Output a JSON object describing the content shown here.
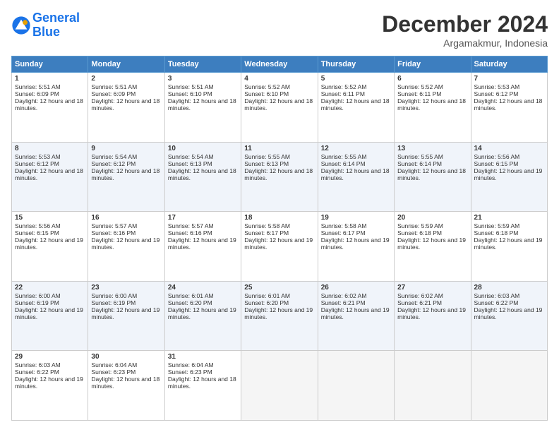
{
  "header": {
    "logo_line1": "General",
    "logo_line2": "Blue",
    "month_year": "December 2024",
    "location": "Argamakmur, Indonesia"
  },
  "days_of_week": [
    "Sunday",
    "Monday",
    "Tuesday",
    "Wednesday",
    "Thursday",
    "Friday",
    "Saturday"
  ],
  "weeks": [
    [
      {
        "day": "1",
        "sunrise": "Sunrise: 5:51 AM",
        "sunset": "Sunset: 6:09 PM",
        "daylight": "Daylight: 12 hours and 18 minutes."
      },
      {
        "day": "2",
        "sunrise": "Sunrise: 5:51 AM",
        "sunset": "Sunset: 6:09 PM",
        "daylight": "Daylight: 12 hours and 18 minutes."
      },
      {
        "day": "3",
        "sunrise": "Sunrise: 5:51 AM",
        "sunset": "Sunset: 6:10 PM",
        "daylight": "Daylight: 12 hours and 18 minutes."
      },
      {
        "day": "4",
        "sunrise": "Sunrise: 5:52 AM",
        "sunset": "Sunset: 6:10 PM",
        "daylight": "Daylight: 12 hours and 18 minutes."
      },
      {
        "day": "5",
        "sunrise": "Sunrise: 5:52 AM",
        "sunset": "Sunset: 6:11 PM",
        "daylight": "Daylight: 12 hours and 18 minutes."
      },
      {
        "day": "6",
        "sunrise": "Sunrise: 5:52 AM",
        "sunset": "Sunset: 6:11 PM",
        "daylight": "Daylight: 12 hours and 18 minutes."
      },
      {
        "day": "7",
        "sunrise": "Sunrise: 5:53 AM",
        "sunset": "Sunset: 6:12 PM",
        "daylight": "Daylight: 12 hours and 18 minutes."
      }
    ],
    [
      {
        "day": "8",
        "sunrise": "Sunrise: 5:53 AM",
        "sunset": "Sunset: 6:12 PM",
        "daylight": "Daylight: 12 hours and 18 minutes."
      },
      {
        "day": "9",
        "sunrise": "Sunrise: 5:54 AM",
        "sunset": "Sunset: 6:12 PM",
        "daylight": "Daylight: 12 hours and 18 minutes."
      },
      {
        "day": "10",
        "sunrise": "Sunrise: 5:54 AM",
        "sunset": "Sunset: 6:13 PM",
        "daylight": "Daylight: 12 hours and 18 minutes."
      },
      {
        "day": "11",
        "sunrise": "Sunrise: 5:55 AM",
        "sunset": "Sunset: 6:13 PM",
        "daylight": "Daylight: 12 hours and 18 minutes."
      },
      {
        "day": "12",
        "sunrise": "Sunrise: 5:55 AM",
        "sunset": "Sunset: 6:14 PM",
        "daylight": "Daylight: 12 hours and 18 minutes."
      },
      {
        "day": "13",
        "sunrise": "Sunrise: 5:55 AM",
        "sunset": "Sunset: 6:14 PM",
        "daylight": "Daylight: 12 hours and 18 minutes."
      },
      {
        "day": "14",
        "sunrise": "Sunrise: 5:56 AM",
        "sunset": "Sunset: 6:15 PM",
        "daylight": "Daylight: 12 hours and 19 minutes."
      }
    ],
    [
      {
        "day": "15",
        "sunrise": "Sunrise: 5:56 AM",
        "sunset": "Sunset: 6:15 PM",
        "daylight": "Daylight: 12 hours and 19 minutes."
      },
      {
        "day": "16",
        "sunrise": "Sunrise: 5:57 AM",
        "sunset": "Sunset: 6:16 PM",
        "daylight": "Daylight: 12 hours and 19 minutes."
      },
      {
        "day": "17",
        "sunrise": "Sunrise: 5:57 AM",
        "sunset": "Sunset: 6:16 PM",
        "daylight": "Daylight: 12 hours and 19 minutes."
      },
      {
        "day": "18",
        "sunrise": "Sunrise: 5:58 AM",
        "sunset": "Sunset: 6:17 PM",
        "daylight": "Daylight: 12 hours and 19 minutes."
      },
      {
        "day": "19",
        "sunrise": "Sunrise: 5:58 AM",
        "sunset": "Sunset: 6:17 PM",
        "daylight": "Daylight: 12 hours and 19 minutes."
      },
      {
        "day": "20",
        "sunrise": "Sunrise: 5:59 AM",
        "sunset": "Sunset: 6:18 PM",
        "daylight": "Daylight: 12 hours and 19 minutes."
      },
      {
        "day": "21",
        "sunrise": "Sunrise: 5:59 AM",
        "sunset": "Sunset: 6:18 PM",
        "daylight": "Daylight: 12 hours and 19 minutes."
      }
    ],
    [
      {
        "day": "22",
        "sunrise": "Sunrise: 6:00 AM",
        "sunset": "Sunset: 6:19 PM",
        "daylight": "Daylight: 12 hours and 19 minutes."
      },
      {
        "day": "23",
        "sunrise": "Sunrise: 6:00 AM",
        "sunset": "Sunset: 6:19 PM",
        "daylight": "Daylight: 12 hours and 19 minutes."
      },
      {
        "day": "24",
        "sunrise": "Sunrise: 6:01 AM",
        "sunset": "Sunset: 6:20 PM",
        "daylight": "Daylight: 12 hours and 19 minutes."
      },
      {
        "day": "25",
        "sunrise": "Sunrise: 6:01 AM",
        "sunset": "Sunset: 6:20 PM",
        "daylight": "Daylight: 12 hours and 19 minutes."
      },
      {
        "day": "26",
        "sunrise": "Sunrise: 6:02 AM",
        "sunset": "Sunset: 6:21 PM",
        "daylight": "Daylight: 12 hours and 19 minutes."
      },
      {
        "day": "27",
        "sunrise": "Sunrise: 6:02 AM",
        "sunset": "Sunset: 6:21 PM",
        "daylight": "Daylight: 12 hours and 19 minutes."
      },
      {
        "day": "28",
        "sunrise": "Sunrise: 6:03 AM",
        "sunset": "Sunset: 6:22 PM",
        "daylight": "Daylight: 12 hours and 19 minutes."
      }
    ],
    [
      {
        "day": "29",
        "sunrise": "Sunrise: 6:03 AM",
        "sunset": "Sunset: 6:22 PM",
        "daylight": "Daylight: 12 hours and 19 minutes."
      },
      {
        "day": "30",
        "sunrise": "Sunrise: 6:04 AM",
        "sunset": "Sunset: 6:23 PM",
        "daylight": "Daylight: 12 hours and 18 minutes."
      },
      {
        "day": "31",
        "sunrise": "Sunrise: 6:04 AM",
        "sunset": "Sunset: 6:23 PM",
        "daylight": "Daylight: 12 hours and 18 minutes."
      },
      null,
      null,
      null,
      null
    ]
  ]
}
